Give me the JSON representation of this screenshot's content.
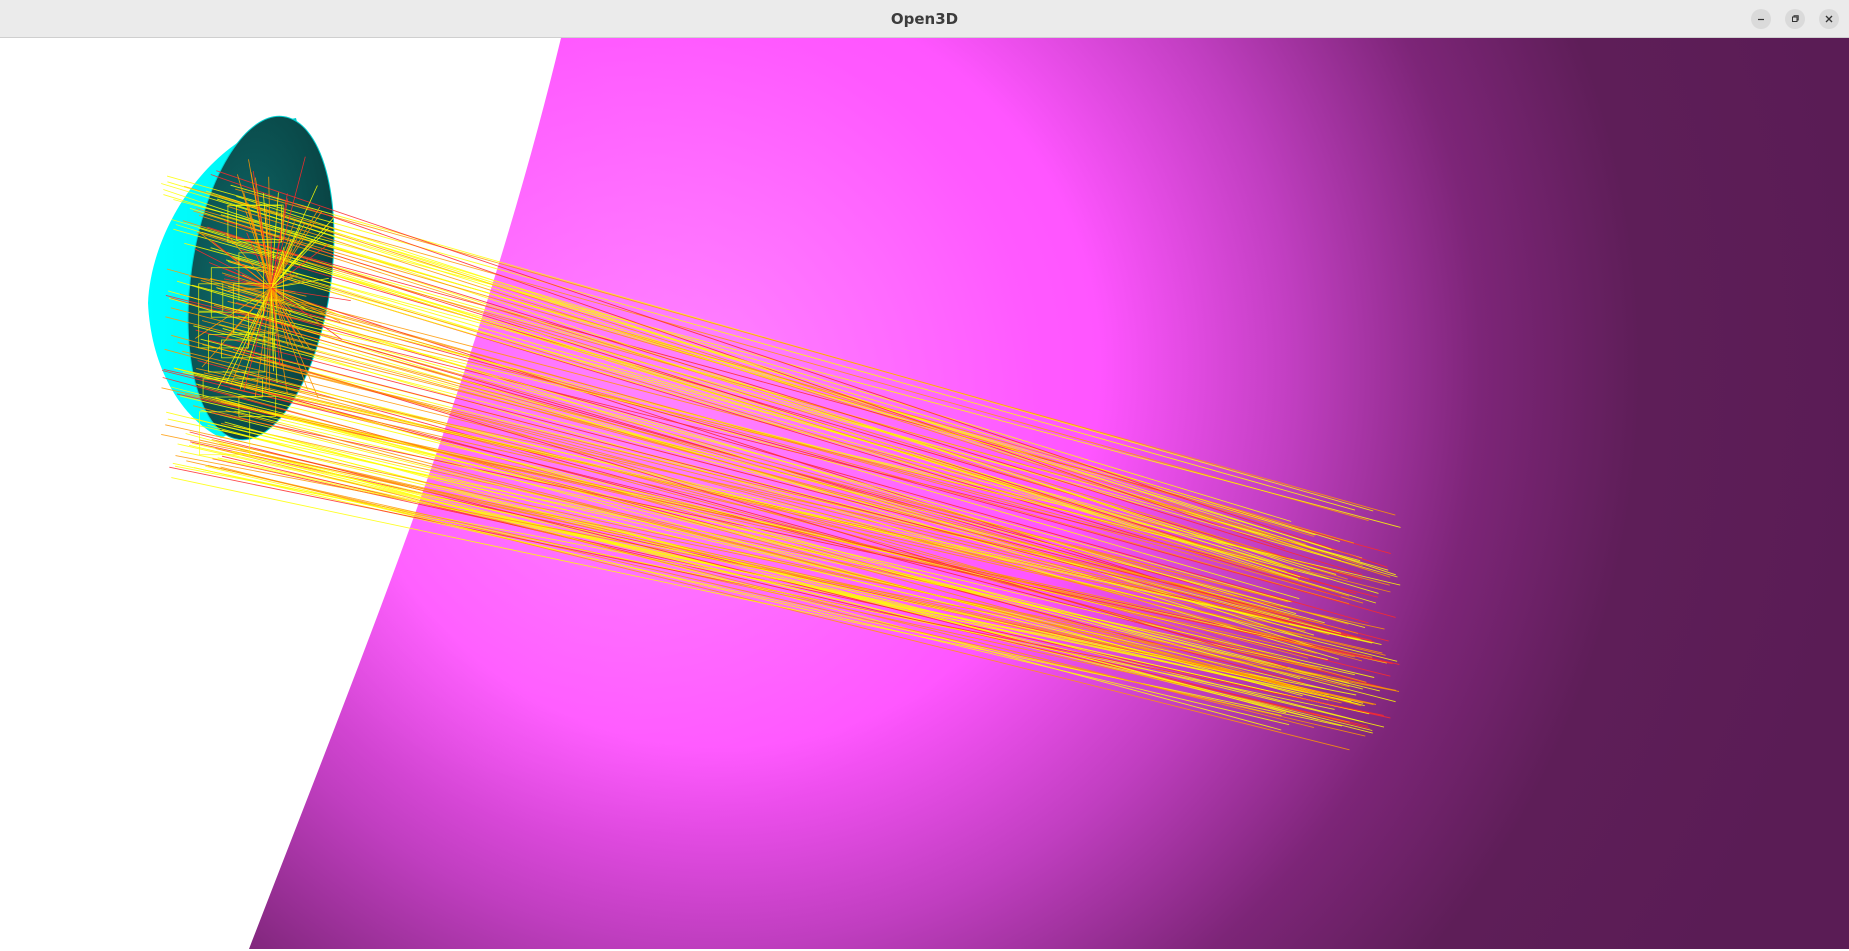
{
  "window": {
    "title": "Open3D",
    "controls": {
      "minimize": "minimize-icon",
      "restore": "restore-icon",
      "close": "close-icon"
    }
  },
  "scene": {
    "objects": [
      {
        "name": "magenta-sphere-surface",
        "color": "#ff55ff",
        "shade": "#5e1e58"
      },
      {
        "name": "cyan-hemispherical-mirror",
        "color": "#00ffff",
        "shade": "#0a4a4a"
      },
      {
        "name": "ray-bundle",
        "colors": [
          "#ffff00",
          "#ff9900",
          "#ff2a2a"
        ]
      }
    ],
    "background": "#ffffff"
  }
}
